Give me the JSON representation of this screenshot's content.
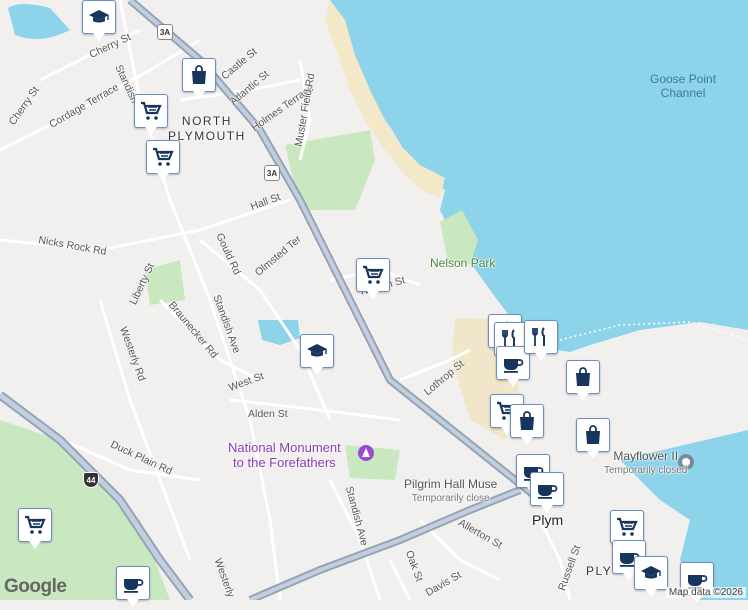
{
  "map": {
    "labels": {
      "cherry_st_top": "Cherry St",
      "cherry_st_left": "Cherry St",
      "standish": "Standish",
      "castle_st": "Castle St",
      "atlantic_st": "Atlantic St",
      "cordage_terrace": "Cordage Terrace",
      "holmes_terrace": "Holmes Terrace",
      "muster_field_rd": "Muster Field Rd",
      "north_plymouth": "NORTH\nPLYMOUTH",
      "goose_point_channel": "Goose Point\nChannel",
      "hall_st": "Hall St",
      "nicks_rock_rd": "Nicks Rock Rd",
      "gould_rd": "Gould Rd",
      "olmsted_ter": "Olmsted Ter",
      "nelson_park": "Nelson Park",
      "nelson_st": "Nelson St",
      "liberty_st": "Liberty St",
      "braunecker_rd": "Braunecker Rd",
      "standish_ave": "Standish Ave",
      "westerly_rd": "Westerly Rd",
      "west_st": "West St",
      "lothrop_st": "Lothrop St",
      "alden_st": "Alden St",
      "national_monument": "National Monument\nto the Forefathers",
      "duck_plain_rd": "Duck Plain Rd",
      "pilgrim_hall": "Pilgrim Hall Muse",
      "pilgrim_hall_sub": "Temporarily close",
      "mayflower": "Mayflower II",
      "mayflower_sub": "Temporarily closed",
      "allerton_st": "Allerton St",
      "standish_ave_south": "Standish Ave",
      "plymouth": "Plym",
      "plymouth_caps": "PLY",
      "oak_st": "Oak St",
      "davis_st": "Davis St",
      "russell_st": "Russell St",
      "westerly_bottom": "Westerly"
    },
    "shields": {
      "route_3a_top": "3A",
      "route_3a_mid": "3A",
      "us_44": "44"
    },
    "pins": [
      {
        "icon": "school-icon"
      },
      {
        "icon": "shopping-bag-icon"
      },
      {
        "icon": "shopping-cart-icon"
      },
      {
        "icon": "shopping-cart-icon"
      },
      {
        "icon": "shopping-cart-icon"
      },
      {
        "icon": "school-icon"
      },
      {
        "icon": "shopping-cart-icon"
      },
      {
        "icon": "coffee-icon"
      },
      {
        "icon": "restaurant-icon"
      },
      {
        "icon": "restaurant-icon"
      },
      {
        "icon": "coffee-icon"
      },
      {
        "icon": "restaurant-icon"
      },
      {
        "icon": "shopping-bag-icon"
      },
      {
        "icon": "shopping-cart-icon"
      },
      {
        "icon": "shopping-bag-icon"
      },
      {
        "icon": "shopping-bag-icon"
      },
      {
        "icon": "coffee-icon"
      },
      {
        "icon": "coffee-icon"
      },
      {
        "icon": "shopping-cart-icon"
      },
      {
        "icon": "coffee-icon"
      },
      {
        "icon": "school-icon"
      },
      {
        "icon": "coffee-icon"
      }
    ],
    "colors": {
      "water": "#8dd3ea",
      "land": "#f2f0ee",
      "park": "#c9e8c0",
      "highway": "#93a4b8",
      "road": "#ffffff",
      "beach": "#f3e8c8",
      "pin_icon": "#17365d"
    }
  },
  "footer": {
    "logo": "Google",
    "attribution": "Map data ©2026"
  }
}
